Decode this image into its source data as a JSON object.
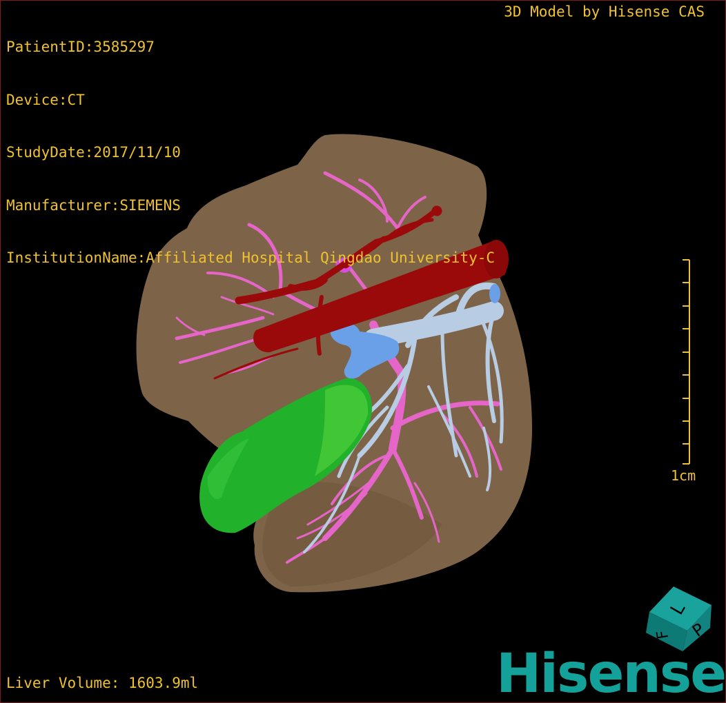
{
  "overlay": {
    "patient_id": "PatientID:3585297",
    "device": "Device:CT",
    "study_date": "StudyDate:2017/11/10",
    "manufacturer": "Manufacturer:SIEMENS",
    "institution": "InstitutionName:Affiliated Hospital Qingdao University-C",
    "credit": "3D Model by Hisense CAS",
    "liver_volume": "Liver Volume: 1603.9ml"
  },
  "scale_bar": {
    "label": "1cm",
    "ticks": 9
  },
  "orientation_cube": {
    "face_top": "L",
    "face_right": "P",
    "face_left": "F"
  },
  "logo": {
    "text": "Hisense"
  },
  "colors": {
    "overlay_text": "#f0c230",
    "liver": "#7d6347",
    "inferior_vena_cava": "#9b0a0a",
    "portal_vein_branches": "#e566c8",
    "hepatic_vein": "#b8cce4",
    "gallbladder": "#22b12a",
    "blue_structure": "#6aa0e8",
    "logo": "#13a19a",
    "cube": "#12837f"
  }
}
